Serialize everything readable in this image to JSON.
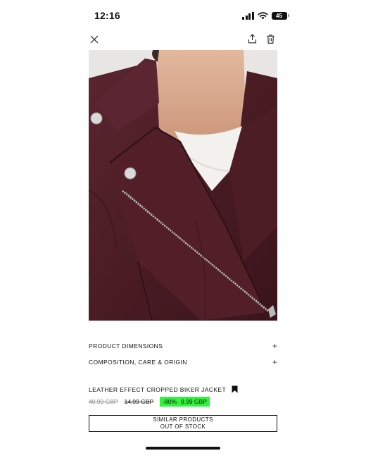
{
  "status_bar": {
    "time": "12:16",
    "battery_level": "45"
  },
  "topbar": {
    "close_icon": "close-icon",
    "share_icon": "share-icon",
    "delete_icon": "trash-icon"
  },
  "product": {
    "image_icon": "product-photo",
    "name": "LEATHER EFFECT CROPPED BIKER JACKET",
    "price_original": "49.99 GBP",
    "price_previous": "14.99 GBP",
    "discount": "-80%",
    "price_current": "9.99 GBP",
    "colors": {
      "sale_highlight": "#32f23f",
      "jacket": "#4a1c24"
    }
  },
  "details": {
    "dimensions_label": "PRODUCT DIMENSIONS",
    "composition_label": "COMPOSITION, CARE & ORIGIN",
    "expand_symbol": "+"
  },
  "similar_button": {
    "line1": "SIMILAR PRODUCTS",
    "line2": "OUT OF STOCK"
  }
}
